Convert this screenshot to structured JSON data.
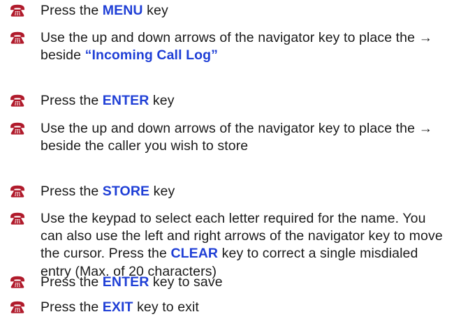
{
  "icon": "telephone-icon",
  "colors": {
    "text": "#1a1a1a",
    "highlight": "#1f3fd6",
    "icon": "#b01a2b"
  },
  "steps": [
    {
      "parts": [
        {
          "t": "Press the "
        },
        {
          "t": "MENU",
          "hl": true
        },
        {
          "t": " key"
        }
      ]
    },
    {
      "parts": [
        {
          "t": "Use the up and down arrows of the navigator key to place the → beside "
        },
        {
          "t": "“Incoming Call Log”",
          "hl": true
        }
      ]
    },
    {
      "parts": [
        {
          "t": "Press the "
        },
        {
          "t": "ENTER",
          "hl": true
        },
        {
          "t": " key"
        }
      ]
    },
    {
      "parts": [
        {
          "t": "Use the up and down arrows of the navigator key to place the → beside the caller you wish to store"
        }
      ]
    },
    {
      "parts": [
        {
          "t": "Press the "
        },
        {
          "t": "STORE",
          "hl": true
        },
        {
          "t": " key"
        }
      ]
    },
    {
      "parts": [
        {
          "t": "Use the keypad to select each letter required for the name.  You can also use the left and right arrows of the navigator key to move the cursor.  Press the "
        },
        {
          "t": "CLEAR",
          "hl": true
        },
        {
          "t": " key to correct a single misdialed entry (Max. of 20 characters)"
        }
      ]
    },
    {
      "parts": [
        {
          "t": "Press the "
        },
        {
          "t": "ENTER",
          "hl": true
        },
        {
          "t": " key to save"
        }
      ]
    },
    {
      "parts": [
        {
          "t": "Press the "
        },
        {
          "t": "EXIT",
          "hl": true
        },
        {
          "t": " key to exit"
        }
      ]
    }
  ]
}
